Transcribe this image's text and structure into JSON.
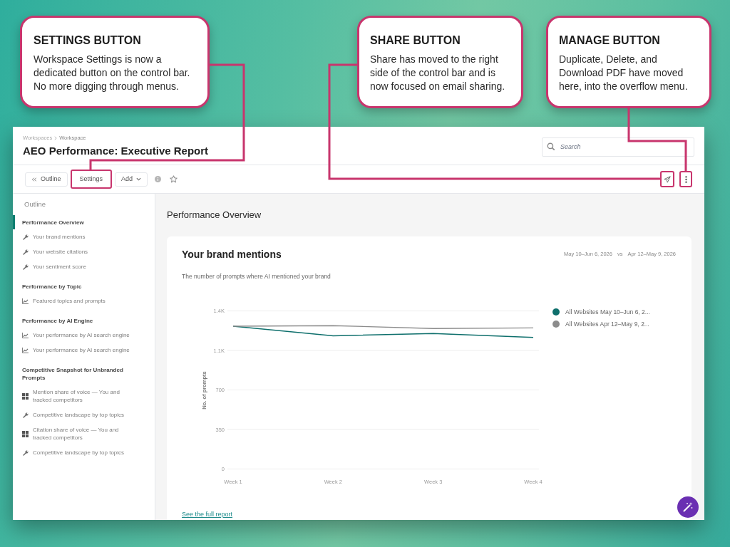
{
  "callouts": [
    {
      "title": "SETTINGS BUTTON",
      "text": "Workspace Settings is now a dedicated button on the control bar. No more digging through menus."
    },
    {
      "title": "SHARE BUTTON",
      "text": "Share has moved to the right side of the control bar and is now focused on email sharing."
    },
    {
      "title": "MANAGE BUTTON",
      "text": "Duplicate, Delete, and Download PDF have moved here, into the overflow menu."
    }
  ],
  "app": {
    "breadcrumb": [
      "Workspaces",
      "Workspace"
    ],
    "title": "AEO Performance: Executive Report",
    "search": {
      "placeholder": "Search"
    },
    "toolbar": {
      "buttons": [
        {
          "kind": "outline",
          "label": "Outline",
          "highlighted": false
        },
        {
          "kind": "plain",
          "label": "Settings",
          "highlighted": true
        },
        {
          "kind": "dropdown",
          "label": "Add",
          "highlighted": false
        }
      ],
      "right_buttons": [
        {
          "kind": "share",
          "highlighted": true
        },
        {
          "kind": "more",
          "highlighted": true
        }
      ]
    },
    "sidebar": {
      "heading": "Outline",
      "sections": [
        {
          "title": "Performance Overview",
          "selected": true,
          "items": [
            {
              "kind": "wrench",
              "label": "Your brand mentions"
            },
            {
              "kind": "wrench",
              "label": "Your website citations"
            },
            {
              "kind": "wrench",
              "label": "Your sentiment score"
            }
          ]
        },
        {
          "title": "Performance by Topic",
          "selected": false,
          "items": [
            {
              "kind": "chart",
              "label": "Featured topics and prompts"
            }
          ]
        },
        {
          "title": "Performance by AI Engine",
          "selected": false,
          "items": [
            {
              "kind": "chart",
              "label": "Your performance by AI search engine"
            },
            {
              "kind": "chart",
              "label": "Your performance by AI search engine"
            }
          ]
        },
        {
          "title": "Competitive Snapshot for Unbranded Prompts",
          "selected": false,
          "items": [
            {
              "kind": "grid",
              "label": "Mention share of voice — You and tracked competitors"
            },
            {
              "kind": "wrench",
              "label": "Competitive landscape by top topics"
            },
            {
              "kind": "grid",
              "label": "Citation share of voice — You and tracked competitors"
            },
            {
              "kind": "wrench",
              "label": "Competitive landscape by top topics"
            }
          ]
        }
      ]
    },
    "main": {
      "title": "Performance Overview",
      "card": {
        "title": "Your brand mentions",
        "date_range": "May 10–Jun 6, 2026",
        "comparison_word": "vs",
        "comparison_range": "Apr 12–May 9, 2026",
        "subtitle": "The number of prompts where AI mentioned your brand",
        "chart_data": [
          {
            "type": "line",
            "ylabel": "No. of prompts",
            "categories": [
              "Week 1",
              "Week 2",
              "Week 3",
              "Week 4"
            ],
            "ylim": [
              0,
              1400
            ],
            "yticks": [
              {
                "value": 0,
                "label": "0"
              },
              {
                "value": 350,
                "label": "350"
              },
              {
                "value": 700,
                "label": "700"
              },
              {
                "value": 1050,
                "label": "1.1K"
              },
              {
                "value": 1400,
                "label": "1.4K"
              }
            ],
            "grid": true,
            "legend": "right",
            "series": [
              {
                "name": "All Websites May 10–Jun 6, 2...",
                "color": "#0e6f6c",
                "values": [
                  1265,
                  1180,
                  1200,
                  1165
                ]
              },
              {
                "name": "All Websites Apr 12–May 9, 2...",
                "color": "#8c8c8c",
                "values": [
                  1265,
                  1270,
                  1245,
                  1250
                ]
              }
            ]
          }
        ],
        "link": "See the full report"
      }
    }
  }
}
